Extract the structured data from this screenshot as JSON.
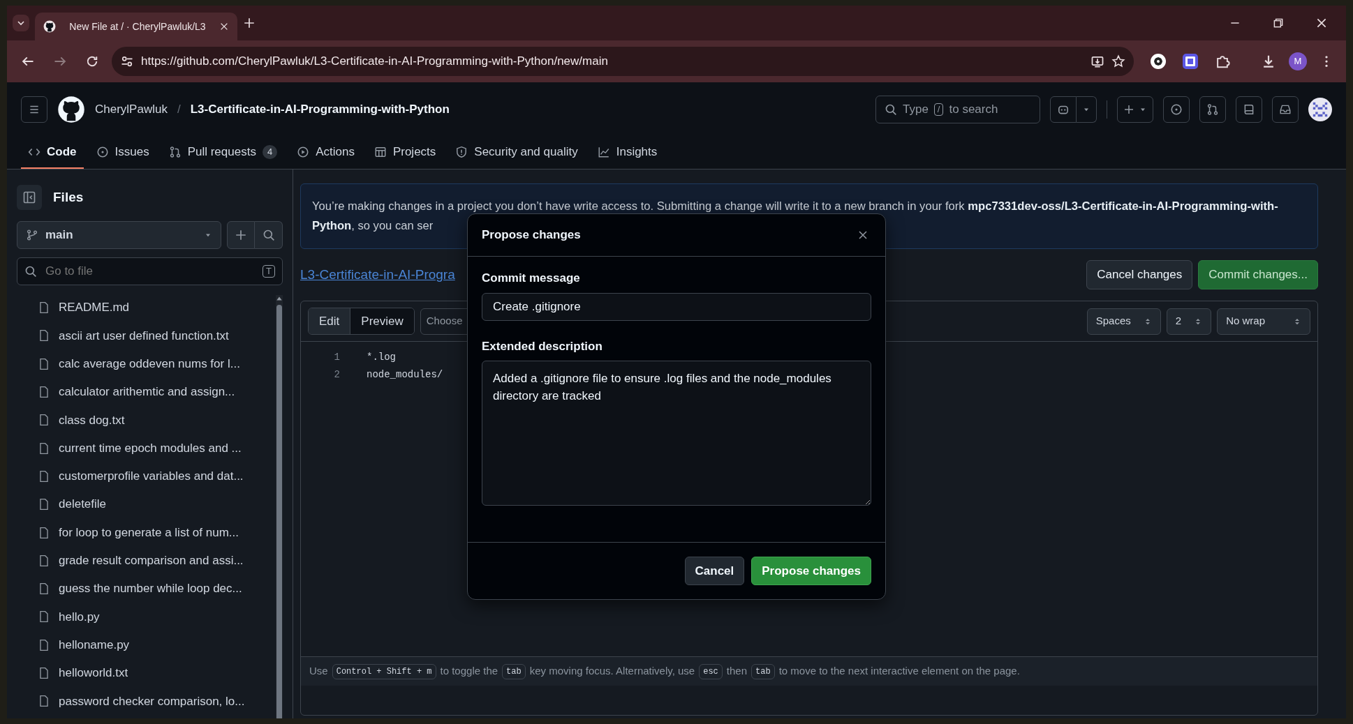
{
  "browser": {
    "tabs": [
      {
        "title": "New File at / · CherylPawluk/L3",
        "selected": true
      }
    ],
    "url": "https://github.com/CherylPawluk/L3-Certificate-in-AI-Programming-with-Python/new/main",
    "profile_initial": "M"
  },
  "header": {
    "owner": "CherylPawluk",
    "separator": "/",
    "repo": "L3-Certificate-in-AI-Programming-with-Python",
    "search": {
      "before": "Type",
      "key": "/",
      "after": "to search"
    },
    "nav": [
      {
        "label": "Code",
        "selected": true
      },
      {
        "label": "Issues",
        "selected": false
      },
      {
        "label": "Pull requests",
        "selected": false,
        "counter": "4"
      },
      {
        "label": "Actions",
        "selected": false
      },
      {
        "label": "Projects",
        "selected": false
      },
      {
        "label": "Security and quality",
        "selected": false
      },
      {
        "label": "Insights",
        "selected": false
      }
    ]
  },
  "sidebar": {
    "title": "Files",
    "branch": "main",
    "filter": {
      "placeholder": "Go to file",
      "shortcut": "T"
    },
    "files": [
      "README.md",
      "ascii art user defined function.txt",
      "calc average oddeven nums for l...",
      "calculator arithemtic and assign...",
      "class dog.txt",
      "current time epoch modules and ...",
      "customerprofile variables and dat...",
      "deletefile",
      "for loop to generate a list of num...",
      "grade result comparison and assi...",
      "guess the number while loop dec...",
      "hello.py",
      "helloname.py",
      "helloworld.txt",
      "password checker comparison, lo..."
    ]
  },
  "banner": {
    "text": "You’re making changes in a project you don’t have write access to. Submitting a change will write it to a new branch in your fork **mpc7331dev-oss/L3-Certificate-in-AI-Programming-with-Python**, so you can ser"
  },
  "editor": {
    "path": "L3-Certificate-in-AI-Progra",
    "actions": [
      {
        "label": "Cancel changes",
        "kind": "secondary"
      },
      {
        "label": "Commit changes...",
        "kind": "primary"
      }
    ],
    "tabs": [
      {
        "label": "Edit",
        "selected": true
      },
      {
        "label": "Preview",
        "selected": false
      }
    ],
    "template_placeholder": "Choose",
    "selects": [
      "Spaces",
      "2",
      "No wrap"
    ],
    "lines": [
      {
        "number": "1",
        "code": "*.log"
      },
      {
        "number": "2",
        "code": "node_modules/"
      }
    ],
    "hint": [
      {
        "kind": "text",
        "text": "Use"
      },
      {
        "kind": "key",
        "text": "Control + Shift + m"
      },
      {
        "kind": "text",
        "text": "to toggle the"
      },
      {
        "kind": "key",
        "text": "tab"
      },
      {
        "kind": "text",
        "text": "key moving focus. Alternatively, use"
      },
      {
        "kind": "key",
        "text": "esc"
      },
      {
        "kind": "text",
        "text": "then"
      },
      {
        "kind": "key",
        "text": "tab"
      },
      {
        "kind": "text",
        "text": "to move to the next interactive element on the page."
      }
    ]
  },
  "dialog": {
    "title": "Propose changes",
    "message_label": "Commit message",
    "message": "Create .gitignore",
    "description_label": "Extended description",
    "description": "Added a .gitignore file to ensure .log files and the node_modules directory are tracked",
    "buttons": [
      {
        "label": "Cancel",
        "kind": "secondary"
      },
      {
        "label": "Propose changes",
        "kind": "primary"
      }
    ]
  }
}
